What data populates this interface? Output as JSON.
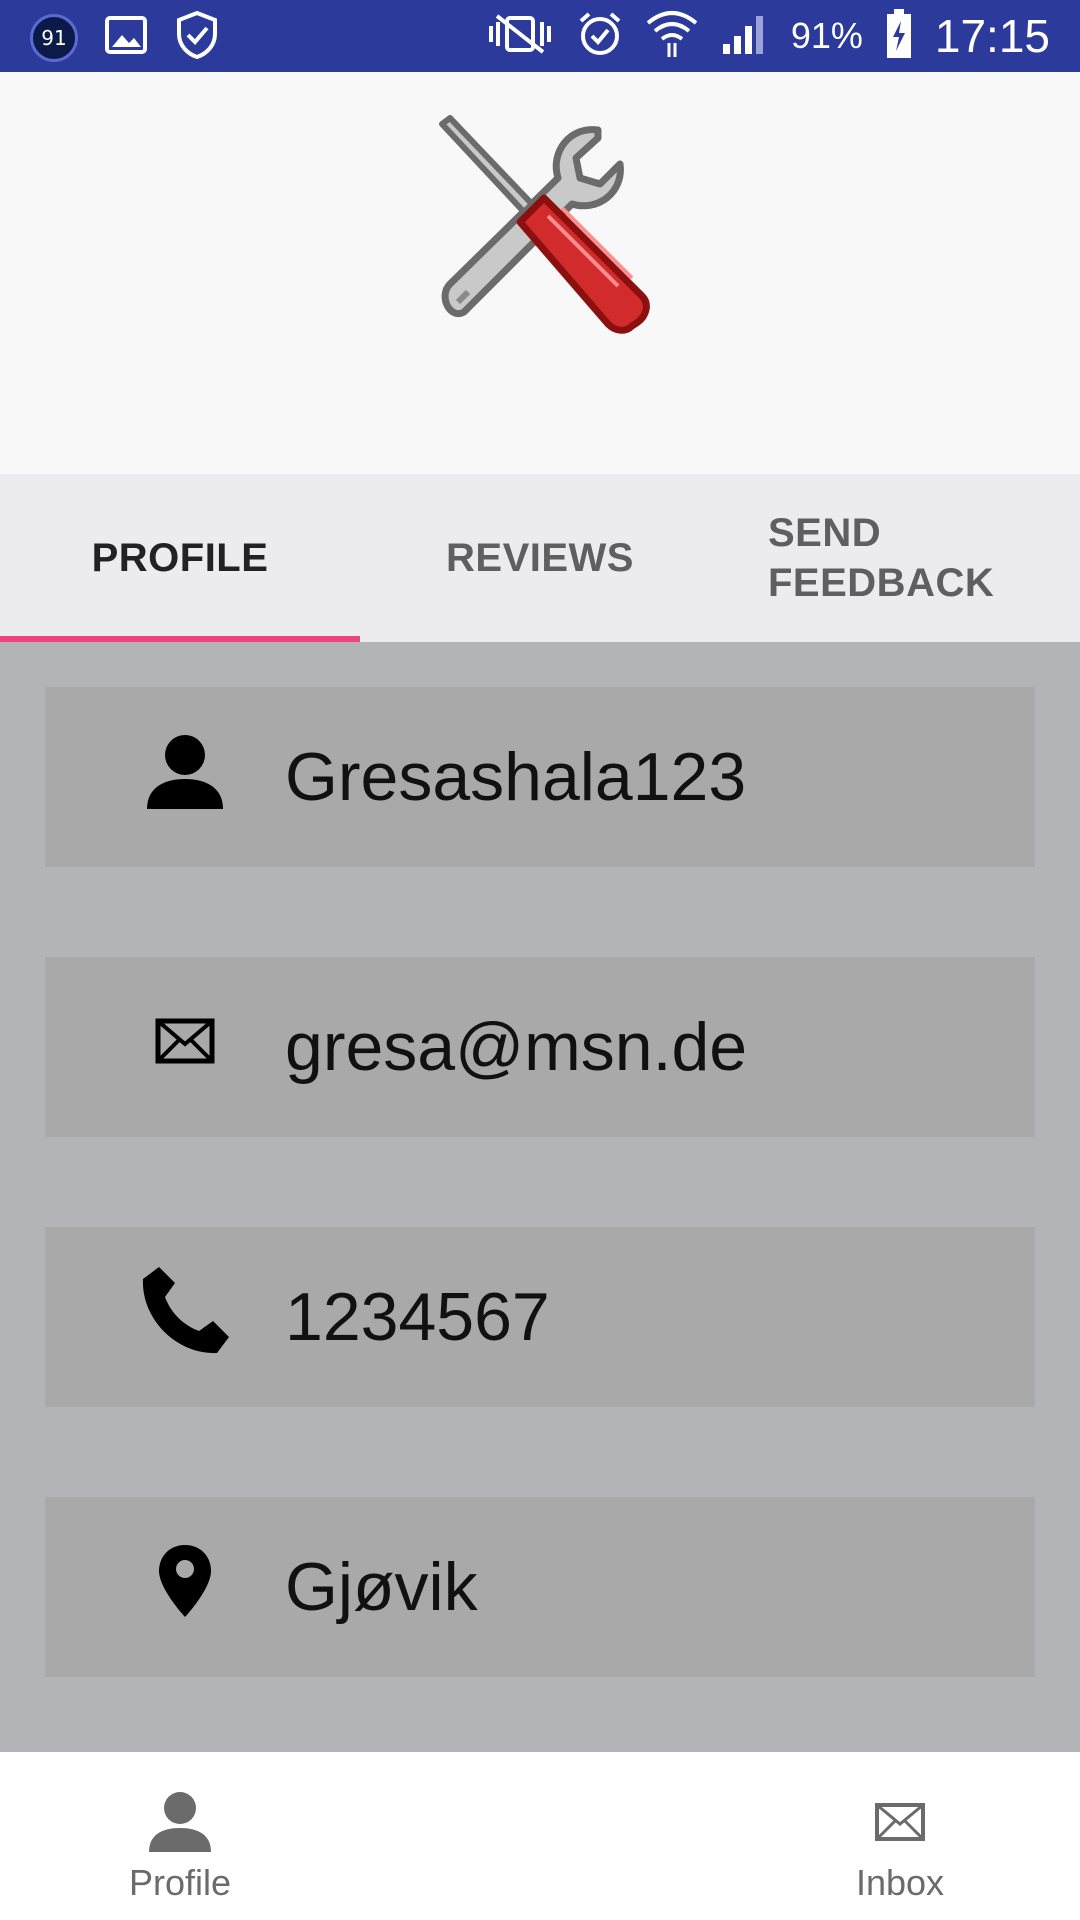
{
  "status_bar": {
    "notification_count": "91",
    "battery": "91%",
    "time": "17:15",
    "bg_color": "#2b3a9b"
  },
  "tabs": [
    {
      "label": "PROFILE",
      "active": true
    },
    {
      "label": "REVIEWS",
      "active": false
    },
    {
      "label": "SEND FEEDBACK",
      "line1": "SEND",
      "line2": "FEEDBACK",
      "active": false
    }
  ],
  "tab_indicator_color": "#ee4380",
  "profile": {
    "username": {
      "value": "Gresashala123",
      "icon": "person-icon"
    },
    "email": {
      "value": "gresa@msn.de",
      "icon": "envelope-icon"
    },
    "phone": {
      "value": "1234567",
      "icon": "phone-icon"
    },
    "location": {
      "value": "Gjøvik",
      "icon": "map-pin-icon"
    }
  },
  "bottom_nav": [
    {
      "label": "Profile",
      "icon": "person-icon"
    },
    {
      "label": "Inbox",
      "icon": "envelope-icon"
    }
  ]
}
